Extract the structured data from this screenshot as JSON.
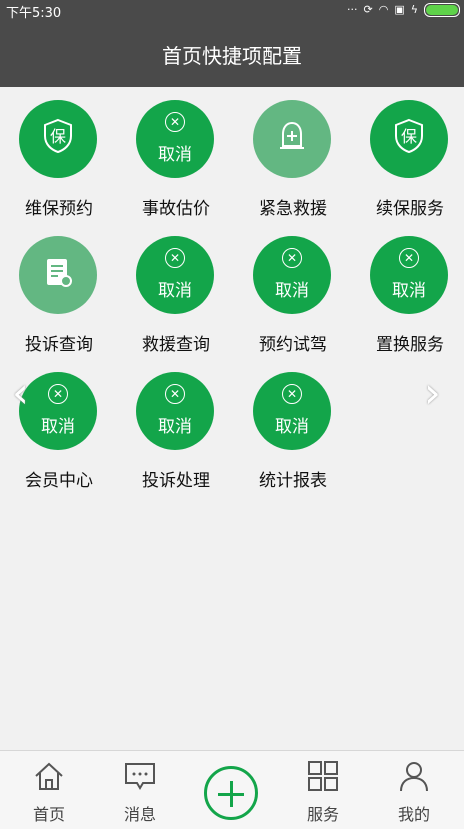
{
  "status": {
    "time": "下午5:30"
  },
  "header": {
    "title": "首页快捷项配置"
  },
  "grid": {
    "cancel_text": "取消",
    "items": [
      {
        "label": "维保预约",
        "icon": "shield-icon",
        "icon_text": "保",
        "state": "active"
      },
      {
        "label": "事故估价",
        "icon": "close-circle-icon",
        "state": "cancel"
      },
      {
        "label": "紧急救援",
        "icon": "alarm-light-icon",
        "state": "inactive"
      },
      {
        "label": "续保服务",
        "icon": "shield-icon",
        "icon_text": "保",
        "state": "active"
      },
      {
        "label": "投诉查询",
        "icon": "clipboard-search-icon",
        "state": "inactive"
      },
      {
        "label": "救援查询",
        "icon": "close-circle-icon",
        "state": "cancel"
      },
      {
        "label": "预约试驾",
        "icon": "close-circle-icon",
        "state": "cancel"
      },
      {
        "label": "置换服务",
        "icon": "close-circle-icon",
        "state": "cancel"
      },
      {
        "label": "会员中心",
        "icon": "close-circle-icon",
        "state": "cancel"
      },
      {
        "label": "投诉处理",
        "icon": "close-circle-icon",
        "state": "cancel"
      },
      {
        "label": "统计报表",
        "icon": "close-circle-icon",
        "state": "cancel"
      }
    ]
  },
  "tabs": {
    "home": "首页",
    "messages": "消息",
    "services": "服务",
    "mine": "我的"
  },
  "colors": {
    "accent": "#13a54a",
    "header": "#4a4a4a"
  }
}
